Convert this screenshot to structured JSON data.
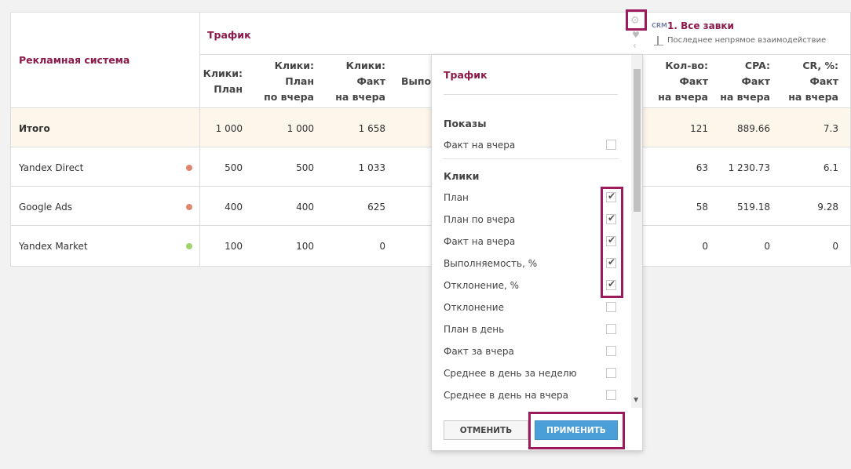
{
  "table": {
    "col_system_header": "Рекламная система",
    "group_traffic": "Трафик",
    "headers": {
      "clicks_plan": [
        "Клики:",
        "План"
      ],
      "clicks_plan_yesterday": [
        "Клики:",
        "План",
        "по вчера"
      ],
      "clicks_fact_yesterday": [
        "Клики:",
        "Факт",
        "на вчера"
      ],
      "fulfil": "Выпол",
      "count": [
        "Кол-во:",
        "Факт",
        "на вчера"
      ],
      "cpa": [
        "CPA:",
        "Факт",
        "на вчера"
      ],
      "cr": [
        "CR, %:",
        "Факт",
        "на вчера"
      ]
    },
    "crm": {
      "badge": "CRM",
      "title": "1. Все завки",
      "subtitle": "Последнее непрямое взаимодействие"
    },
    "rows": [
      {
        "name": "Итого",
        "plan": "1 000",
        "plan_yesterday": "1 000",
        "fact": "1 658",
        "count": "121",
        "cpa": "889.66",
        "cr": "7.3"
      },
      {
        "name": "Yandex Direct",
        "plan": "500",
        "plan_yesterday": "500",
        "fact": "1 033",
        "count": "63",
        "cpa": "1 230.73",
        "cr": "6.1",
        "dot_color": "#e0866f"
      },
      {
        "name": "Google Ads",
        "plan": "400",
        "plan_yesterday": "400",
        "fact": "625",
        "count": "58",
        "cpa": "519.18",
        "cr": "9.28",
        "dot_color": "#e0866f"
      },
      {
        "name": "Yandex Market",
        "plan": "100",
        "plan_yesterday": "100",
        "fact": "0",
        "count": "0",
        "cpa": "0",
        "cr": "0",
        "dot_color": "#9fd46a"
      }
    ]
  },
  "popup": {
    "title": "Трафик",
    "section_impressions": "Показы",
    "impressions_items": [
      {
        "label": "Факт на вчера",
        "checked": false
      }
    ],
    "section_clicks": "Клики",
    "clicks_items": [
      {
        "label": "План",
        "checked": true
      },
      {
        "label": "План по вчера",
        "checked": true
      },
      {
        "label": "Факт на вчера",
        "checked": true
      },
      {
        "label": "Выполняемость, %",
        "checked": true
      },
      {
        "label": "Отклонение, %",
        "checked": true
      },
      {
        "label": "Отклонение",
        "checked": false
      },
      {
        "label": "План в день",
        "checked": false
      },
      {
        "label": "Факт за вчера",
        "checked": false
      },
      {
        "label": "Среднее в день за неделю",
        "checked": false
      },
      {
        "label": "Среднее в день на вчера",
        "checked": false
      }
    ],
    "cancel_label": "ОТМЕНИТЬ",
    "apply_label": "ПРИМЕНИТЬ"
  },
  "colors": {
    "accent": "#8b1a4a",
    "highlight": "#9b1b5c",
    "total_row_bg": "#fdf6ea",
    "apply_bg": "#4b9fd8"
  },
  "icons": [
    "gear-icon",
    "heart-icon",
    "chevron-left-icon",
    "check-icon",
    "bar-icon"
  ]
}
